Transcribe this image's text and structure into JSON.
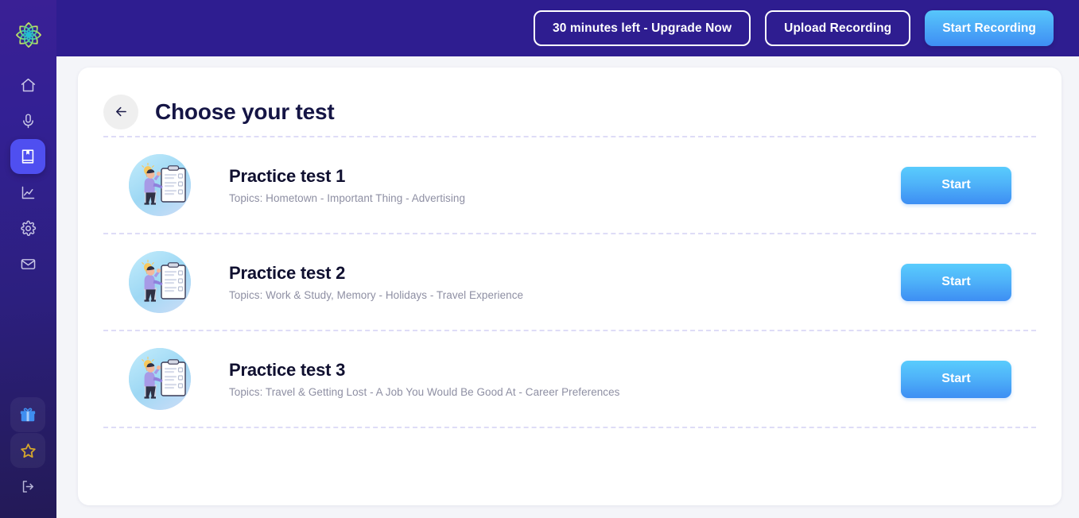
{
  "app": {
    "logo_icon": "flower-star-logo"
  },
  "sidebar": {
    "items": [
      {
        "icon": "home-icon",
        "name": "home",
        "active": false
      },
      {
        "icon": "mic-icon",
        "name": "recording",
        "active": false
      },
      {
        "icon": "book-icon",
        "name": "tests",
        "active": true
      },
      {
        "icon": "chart-icon",
        "name": "progress",
        "active": false
      },
      {
        "icon": "gear-icon",
        "name": "settings",
        "active": false
      },
      {
        "icon": "mail-icon",
        "name": "messages",
        "active": false
      }
    ],
    "bottom_items": [
      {
        "icon": "gift-icon",
        "name": "rewards",
        "color": "#3f8ef0"
      },
      {
        "icon": "star-icon",
        "name": "favorite",
        "color": "#d5a72c"
      },
      {
        "icon": "logout-icon",
        "name": "logout",
        "color": "#b9b7d8"
      }
    ]
  },
  "header": {
    "upgrade_label": "30 minutes left - Upgrade Now",
    "upload_label": "Upload Recording",
    "start_recording_label": "Start Recording",
    "background_color": "#2e1d90",
    "primary_button_color": "#4aa7f7"
  },
  "main": {
    "back_icon": "arrow-left-icon",
    "title": "Choose your test",
    "tests": [
      {
        "title": "Practice test 1",
        "topics": "Topics: Hometown - Important Thing - Advertising",
        "action_label": "Start",
        "illustration": "person-with-checklist-illustration"
      },
      {
        "title": "Practice test 2",
        "topics": "Topics: Work & Study, Memory - Holidays - Travel Experience",
        "action_label": "Start",
        "illustration": "person-with-checklist-illustration"
      },
      {
        "title": "Practice test 3",
        "topics": "Topics: Travel & Getting Lost - A Job You Would Be Good At - Career Preferences",
        "action_label": "Start",
        "illustration": "person-with-checklist-illustration"
      }
    ]
  }
}
